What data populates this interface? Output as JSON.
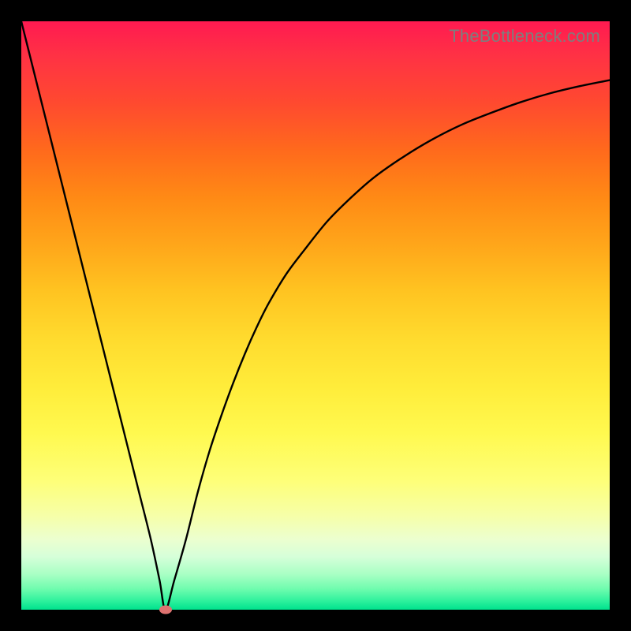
{
  "watermark": "TheBottleneck.com",
  "colors": {
    "frame": "#000000",
    "curve": "#000000",
    "marker": "#de7270"
  },
  "chart_data": {
    "type": "line",
    "title": "",
    "xlabel": "",
    "ylabel": "",
    "xlim": [
      0,
      100
    ],
    "ylim": [
      0,
      100
    ],
    "grid": false,
    "legend": false,
    "series": [
      {
        "name": "bottleneck-curve",
        "x": [
          0,
          2,
          4,
          6,
          8,
          10,
          12,
          14,
          16,
          18,
          20,
          22,
          23.5,
          24.5,
          26,
          28,
          30,
          32,
          34,
          36,
          38,
          40,
          42,
          45,
          48,
          52,
          56,
          60,
          65,
          70,
          75,
          80,
          85,
          90,
          95,
          100
        ],
        "y": [
          100,
          92,
          84,
          76,
          68,
          60,
          52,
          44,
          36,
          28,
          20,
          12,
          5,
          0,
          5,
          12,
          20,
          27,
          33,
          38.5,
          43.5,
          48,
          52,
          57,
          61,
          66,
          70,
          73.5,
          77,
          80,
          82.5,
          84.5,
          86.3,
          87.8,
          89,
          90
        ]
      }
    ],
    "marker": {
      "x": 24.5,
      "y": 0
    },
    "gradient_stops": [
      {
        "pct": 0,
        "color": "#ff1a51"
      },
      {
        "pct": 50,
        "color": "#ffd028"
      },
      {
        "pct": 80,
        "color": "#feff78"
      },
      {
        "pct": 100,
        "color": "#00e28d"
      }
    ]
  }
}
